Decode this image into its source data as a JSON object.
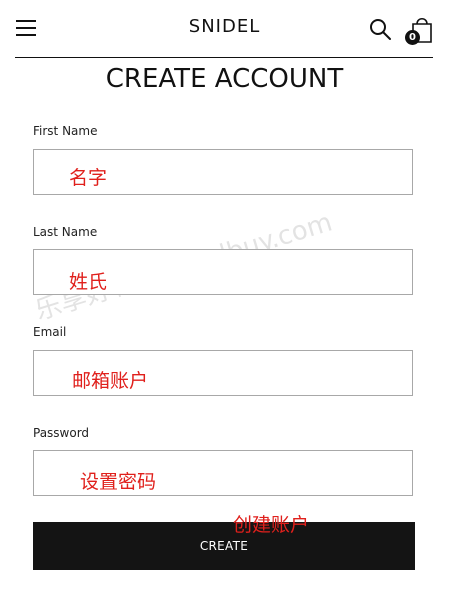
{
  "header": {
    "logo": "SNIDEL",
    "cart_count": "0",
    "icons": {
      "menu": "hamburger-menu-icon",
      "search": "search-icon",
      "cart": "shopping-bag-icon"
    }
  },
  "page": {
    "title": "CREATE ACCOUNT"
  },
  "form": {
    "fields": [
      {
        "label": "First Name",
        "annotation": "名字"
      },
      {
        "label": "Last Name",
        "annotation": "姓氏"
      },
      {
        "label": "Email",
        "annotation": "邮箱账户"
      },
      {
        "label": "Password",
        "annotation": "设置密码"
      }
    ],
    "submit_label": "CREATE",
    "submit_annotation": "创建账户"
  },
  "watermark": "乐享好物 olgoodbuy.com",
  "colors": {
    "annotation": "#e0201c",
    "button_bg": "#141414",
    "border": "#a8a8a8"
  }
}
